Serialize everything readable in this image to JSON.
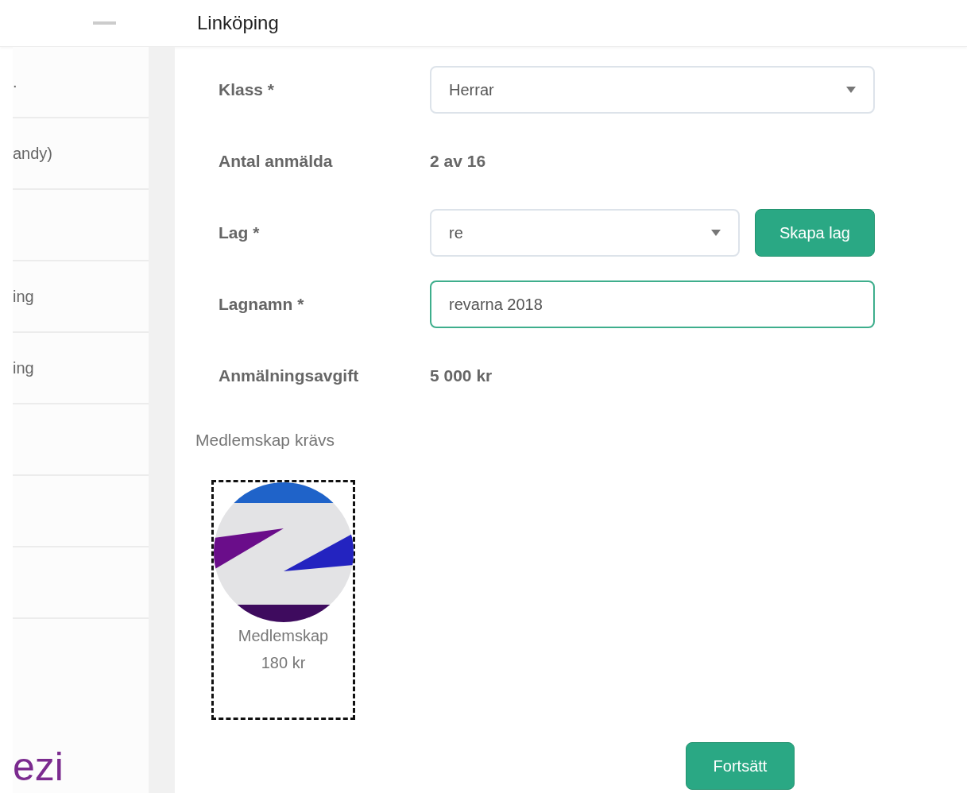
{
  "header": {
    "title": "Linköping"
  },
  "sidebar": {
    "items": [
      {
        "kind": "label",
        "label": "."
      },
      {
        "kind": "label",
        "label": "andy)"
      },
      {
        "kind": "blank"
      },
      {
        "kind": "label",
        "label": "ing"
      },
      {
        "kind": "label",
        "label": "ing"
      },
      {
        "kind": "blank"
      },
      {
        "kind": "blank"
      },
      {
        "kind": "blank"
      }
    ],
    "logo": "ezi"
  },
  "form": {
    "fields": [
      {
        "kind": "select",
        "label": "Klass *",
        "value": "Herrar",
        "focused": false
      },
      {
        "kind": "text",
        "label": "Antal anmälda",
        "value": "2 av 16"
      },
      {
        "kind": "select",
        "label": "Lag *",
        "value": "re",
        "focused": false,
        "button": "Skapa lag"
      },
      {
        "kind": "input",
        "label": "Lagnamn *",
        "value": "revarna 2018",
        "focused": true
      },
      {
        "kind": "text",
        "label": "Anmälningsavgift",
        "value": "5 000 kr"
      }
    ]
  },
  "membership": {
    "heading": "Medlemskap krävs",
    "options": [
      {
        "name": "Medlemskap",
        "price": "180 kr",
        "selected": true
      }
    ]
  },
  "continue_button": "Fortsätt"
}
